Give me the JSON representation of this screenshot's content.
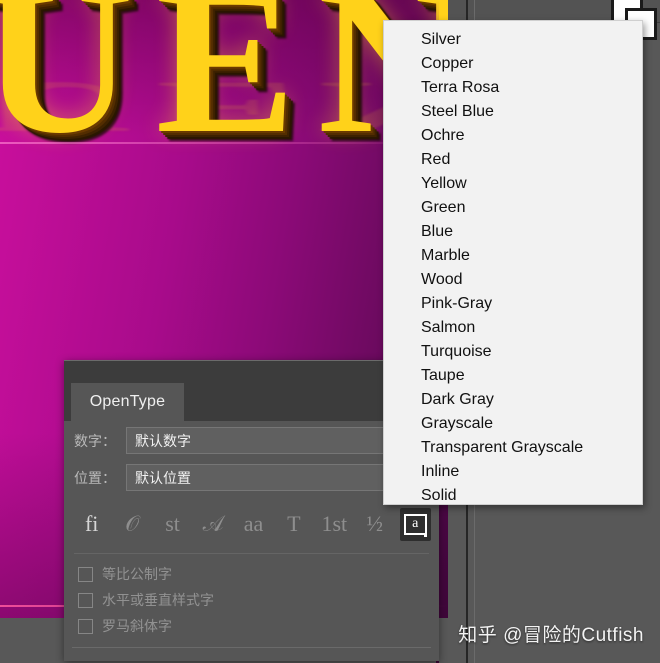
{
  "canvas": {
    "artwork_text": "UEN",
    "gold_color": "#ffd21a",
    "background_start": "#cc0f9e",
    "background_end": "#4a0845"
  },
  "opentype_panel": {
    "tab_label": "OpenType",
    "fields": [
      {
        "label": "数字：",
        "value": "默认数字"
      },
      {
        "label": "位置：",
        "value": "默认位置"
      }
    ],
    "feature_icons": [
      {
        "name": "standard-ligatures-icon",
        "glyph": "fi",
        "state": "enabled"
      },
      {
        "name": "contextual-alternates-icon",
        "glyph": "𝒪",
        "state": "dim"
      },
      {
        "name": "discretionary-ligatures-icon",
        "glyph": "st",
        "state": "dim"
      },
      {
        "name": "swash-icon",
        "glyph": "𝒜",
        "state": "dim"
      },
      {
        "name": "stylistic-alternates-icon",
        "glyph": "aa",
        "state": "dim"
      },
      {
        "name": "titling-alternates-icon",
        "glyph": "T",
        "state": "dim"
      },
      {
        "name": "ordinals-icon",
        "glyph": "1st",
        "state": "dim"
      },
      {
        "name": "fractions-icon",
        "glyph": "½",
        "state": "dim"
      },
      {
        "name": "alternate-glyph-icon",
        "glyph": "a",
        "state": "active"
      }
    ],
    "checkboxes": [
      {
        "label": "等比公制字",
        "checked": false,
        "enabled": false
      },
      {
        "label": "水平或垂直样式字",
        "checked": false,
        "enabled": false
      },
      {
        "label": "罗马斜体字",
        "checked": false,
        "enabled": false
      }
    ]
  },
  "style_dropdown": {
    "items": [
      "Silver",
      "Copper",
      "Terra Rosa",
      "Steel Blue",
      "Ochre",
      "Red",
      "Yellow",
      "Green",
      "Blue",
      "Marble",
      "Wood",
      "Pink-Gray",
      "Salmon",
      "Turquoise",
      "Taupe",
      "Dark Gray",
      "Grayscale",
      "Transparent Grayscale",
      "Inline",
      "Solid"
    ]
  },
  "watermark": {
    "text": "知乎 @冒险的Cutfish"
  }
}
